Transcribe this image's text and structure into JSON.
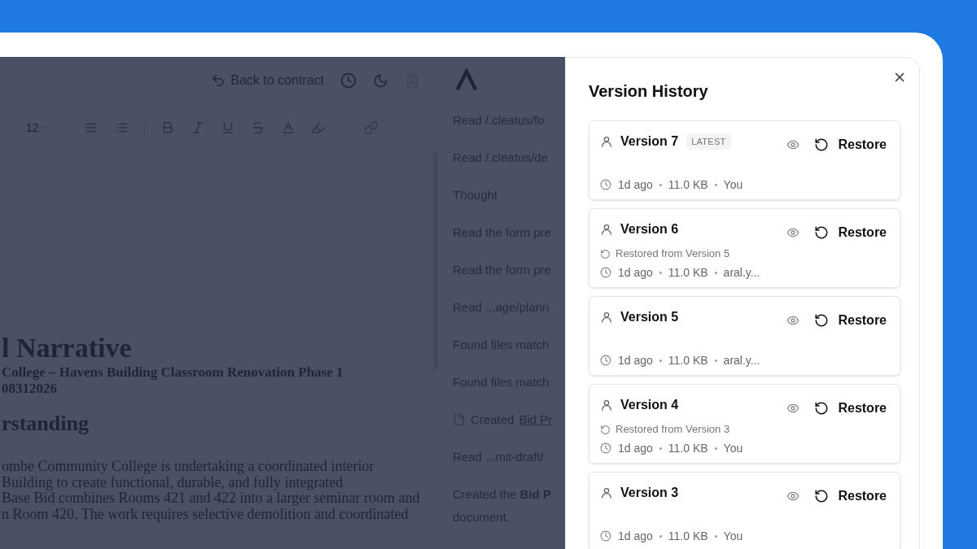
{
  "editor": {
    "back_label": "Back to contract",
    "font_size": "12",
    "heading": "l Narrative",
    "subtitle_lines": [
      "College – Havens Building Classroom Renovation Phase 1",
      "08312026"
    ],
    "section_heading": "rstanding",
    "body_lines": [
      "ombe Community College is undertaking a coordinated interior",
      "Building to create functional, durable, and fully integrated",
      "Base Bid combines Rooms 421 and 422 into a larger seminar room and",
      "n Room 420. The work requires selective demolition and coordinated"
    ]
  },
  "chat": {
    "items": [
      {
        "kind": "step",
        "text": "Read /.cleatus/fo"
      },
      {
        "kind": "step",
        "text": "Read /.cleatus/de"
      },
      {
        "kind": "step",
        "text": "Thought"
      },
      {
        "kind": "step",
        "text": "Read the form pre"
      },
      {
        "kind": "step",
        "text": "Read the form pre"
      },
      {
        "kind": "step",
        "text": "Read ...age/plann"
      },
      {
        "kind": "step",
        "text": "Found files match"
      },
      {
        "kind": "step",
        "text": "Found files match"
      },
      {
        "kind": "file",
        "text": "Created",
        "link": "Bid Pr"
      },
      {
        "kind": "step",
        "text": "Read ...mit-draft/"
      },
      {
        "kind": "message",
        "lines": [
          "Created the **Bid P**",
          "document."
        ]
      }
    ]
  },
  "version_history": {
    "title": "Version History",
    "versions": [
      {
        "name": "Version 7",
        "badge": "LATEST",
        "meta": [
          "1d ago",
          "11.0 KB",
          "You"
        ],
        "restore_label": "Restore"
      },
      {
        "name": "Version 6",
        "restored_from": "Restored from Version 5",
        "meta": [
          "1d ago",
          "11.0 KB",
          "aral.y..."
        ],
        "restore_label": "Restore"
      },
      {
        "name": "Version 5",
        "meta": [
          "1d ago",
          "11.0 KB",
          "aral.y..."
        ],
        "restore_label": "Restore"
      },
      {
        "name": "Version 4",
        "restored_from": "Restored from Version 3",
        "meta": [
          "1d ago",
          "11.0 KB",
          "You"
        ],
        "restore_label": "Restore"
      },
      {
        "name": "Version 3",
        "meta": [
          "1d ago",
          "11.0 KB",
          "You"
        ],
        "restore_label": "Restore"
      }
    ]
  }
}
